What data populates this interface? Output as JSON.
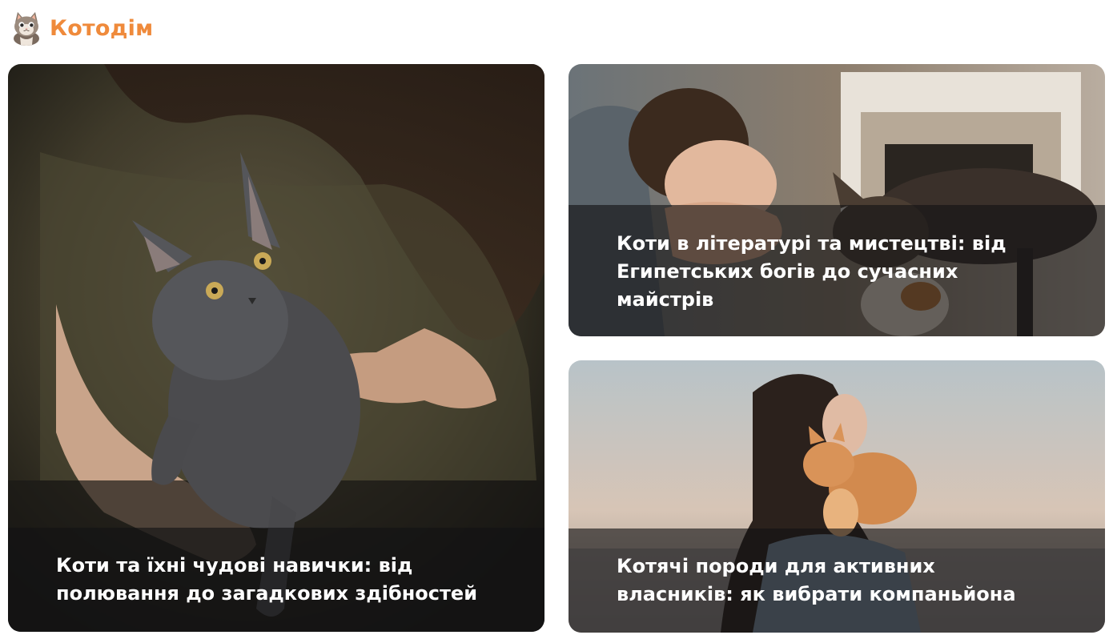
{
  "site": {
    "logo_icon": "cat-mascot-icon",
    "brand_name": "Котодім",
    "brand_color": "#ef8a3b"
  },
  "articles": [
    {
      "title": "Коти та їхні чудові навички: від полювання до загадкових здібностей",
      "image": "woman-holding-gray-kitten"
    },
    {
      "title": "Коти в літературі та мистецтві: від Египетських богів до сучасних майстрів",
      "image": "woman-smiling-at-tabby-cat"
    },
    {
      "title": "Котячі породи для активних власників: як вибрати компаньйона",
      "image": "woman-with-ginger-cat-on-shoulder"
    }
  ]
}
